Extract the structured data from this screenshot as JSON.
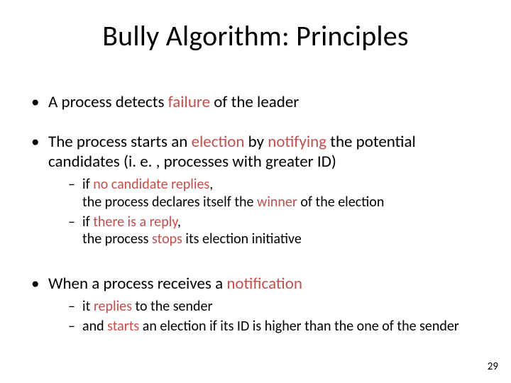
{
  "title": "Bully Algorithm: Principles",
  "b1_pre": "A process detects ",
  "b1_hl": "failure",
  "b1_post": " of the leader",
  "b2_pre": "The process starts an ",
  "b2_hl1": "election",
  "b2_mid": " by ",
  "b2_hl2": "notifying",
  "b2_post": " the potential candidates (i. e. , processes with greater ID)",
  "b2s1_pre": "if ",
  "b2s1_hl": "no candidate replies",
  "b2s1_post": ",",
  "b2s1_line2_pre": "the process declares itself the ",
  "b2s1_line2_hl": "winner",
  "b2s1_line2_post": " of the election",
  "b2s2_pre": "if ",
  "b2s2_hl": "there is a reply",
  "b2s2_post": ",",
  "b2s2_line2_pre": "the process ",
  "b2s2_line2_hl": "stops",
  "b2s2_line2_post": " its election initiative",
  "b3_pre": "When a process receives a ",
  "b3_hl": "notification",
  "b3s1_pre": "it ",
  "b3s1_hl": "replies",
  "b3s1_post": " to the sender",
  "b3s2_pre": "and ",
  "b3s2_hl": "starts",
  "b3s2_post": " an election if its ID is higher than the one of the sender",
  "page_number": "29"
}
